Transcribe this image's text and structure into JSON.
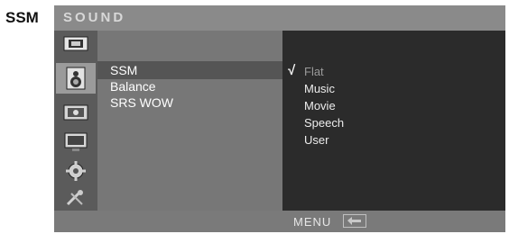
{
  "page_label": "SSM",
  "osd": {
    "title": "SOUND",
    "rail_icons": [
      "picture-icon",
      "sound-icon",
      "timer-icon",
      "screen-icon",
      "setup-gear-icon",
      "tools-icon"
    ],
    "active_rail_index": 1,
    "menu_items": [
      {
        "label": "SSM"
      },
      {
        "label": "Balance"
      },
      {
        "label": "SRS WOW"
      }
    ],
    "selected_menu_index": 0,
    "options": [
      {
        "label": "Flat"
      },
      {
        "label": "Music"
      },
      {
        "label": "Movie"
      },
      {
        "label": "Speech"
      },
      {
        "label": "User"
      }
    ],
    "selected_option_index": 0,
    "check_glyph": "√",
    "footer_hint": "MENU"
  },
  "colors": {
    "header": "#8a8a8a",
    "menu_panel": "#777777",
    "options_panel": "#2b2b2b"
  }
}
